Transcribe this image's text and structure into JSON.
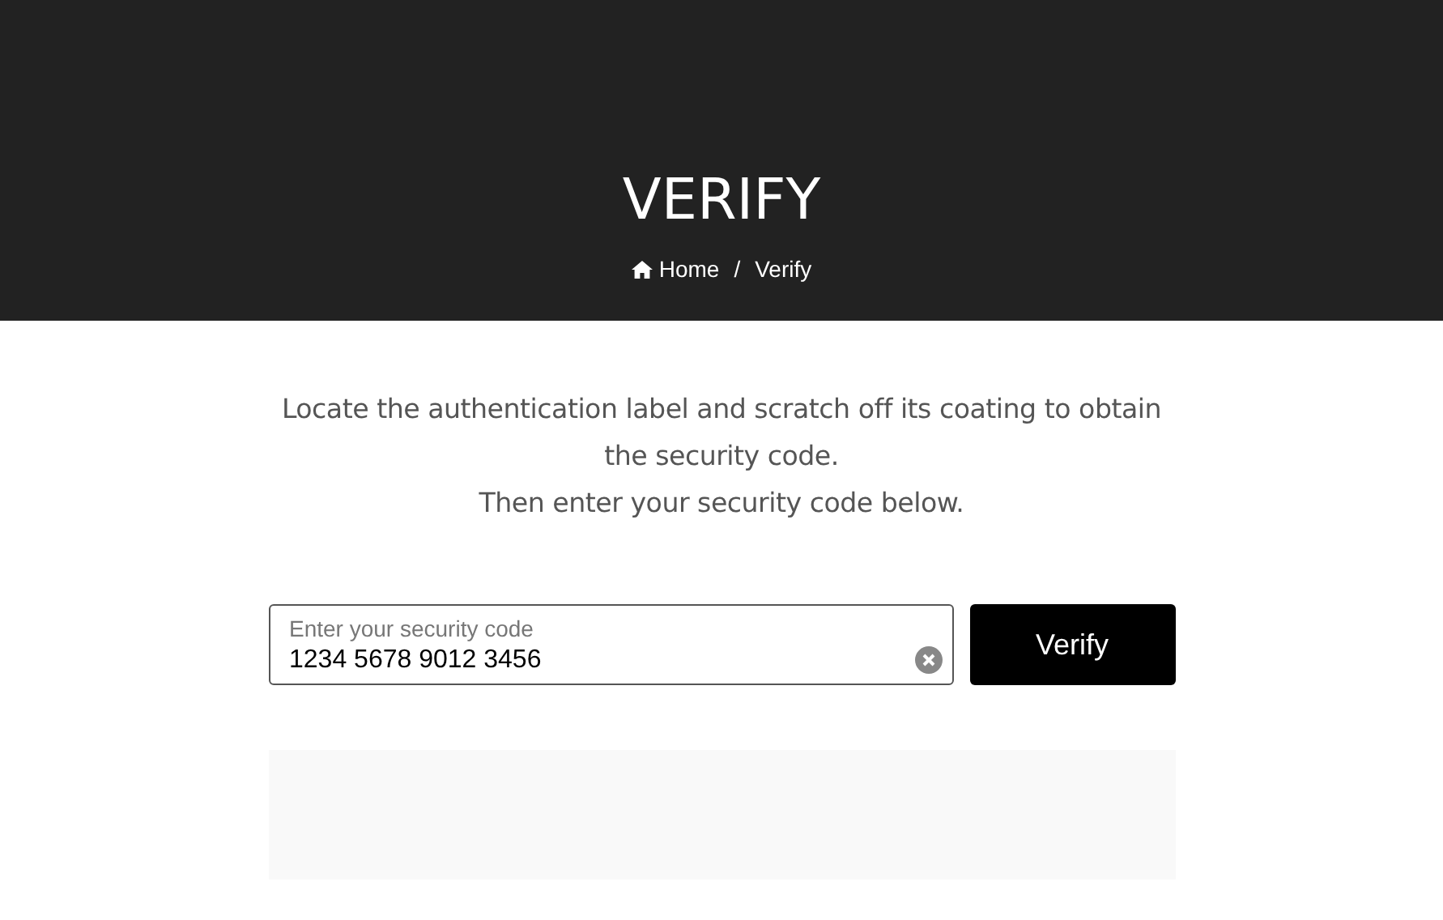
{
  "header": {
    "title": "VERIFY",
    "breadcrumb": [
      {
        "label": "Home",
        "kind": "home"
      },
      {
        "label": "Verify",
        "kind": "current"
      }
    ],
    "separator": "/"
  },
  "instructions": [
    "Locate the authentication label and scratch off its coating to obtain the security code.",
    "Then enter your security code below."
  ],
  "form": {
    "field": {
      "label": "Enter your security code",
      "value": "1234 5678 9012 3456"
    },
    "button": "Verify"
  }
}
